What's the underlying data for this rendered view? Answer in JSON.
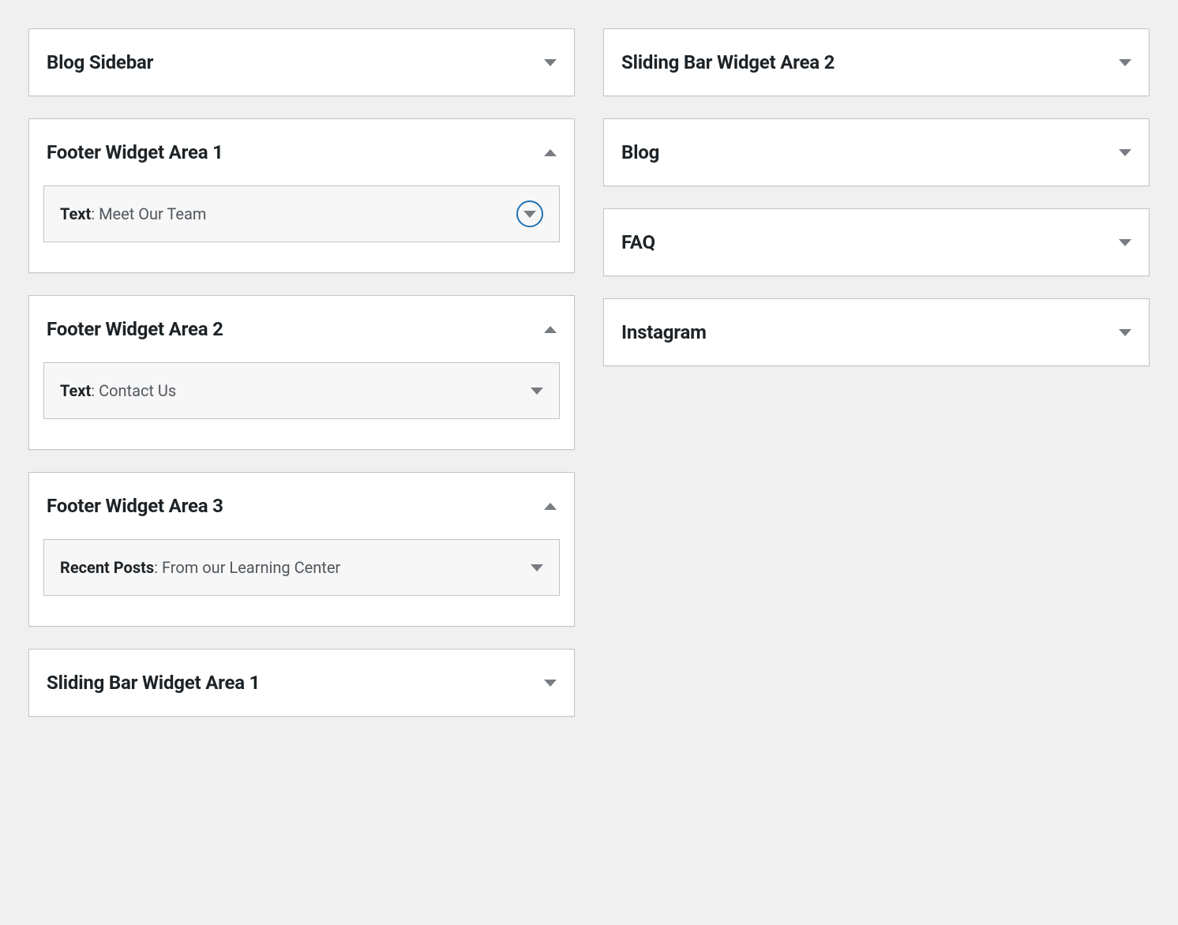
{
  "left": [
    {
      "title": "Blog Sidebar",
      "expanded": false,
      "widgets": []
    },
    {
      "title": "Footer Widget Area 1",
      "expanded": true,
      "widgets": [
        {
          "type": "Text",
          "name": "Meet Our Team",
          "focused": true
        }
      ]
    },
    {
      "title": "Footer Widget Area 2",
      "expanded": true,
      "widgets": [
        {
          "type": "Text",
          "name": "Contact Us",
          "focused": false
        }
      ]
    },
    {
      "title": "Footer Widget Area 3",
      "expanded": true,
      "widgets": [
        {
          "type": "Recent Posts",
          "name": "From our Learning Center",
          "focused": false
        }
      ]
    },
    {
      "title": "Sliding Bar Widget Area 1",
      "expanded": false,
      "widgets": []
    }
  ],
  "right": [
    {
      "title": "Sliding Bar Widget Area 2",
      "expanded": false,
      "widgets": []
    },
    {
      "title": "Blog",
      "expanded": false,
      "widgets": []
    },
    {
      "title": "FAQ",
      "expanded": false,
      "widgets": []
    },
    {
      "title": "Instagram",
      "expanded": false,
      "widgets": []
    }
  ],
  "sep": ": "
}
